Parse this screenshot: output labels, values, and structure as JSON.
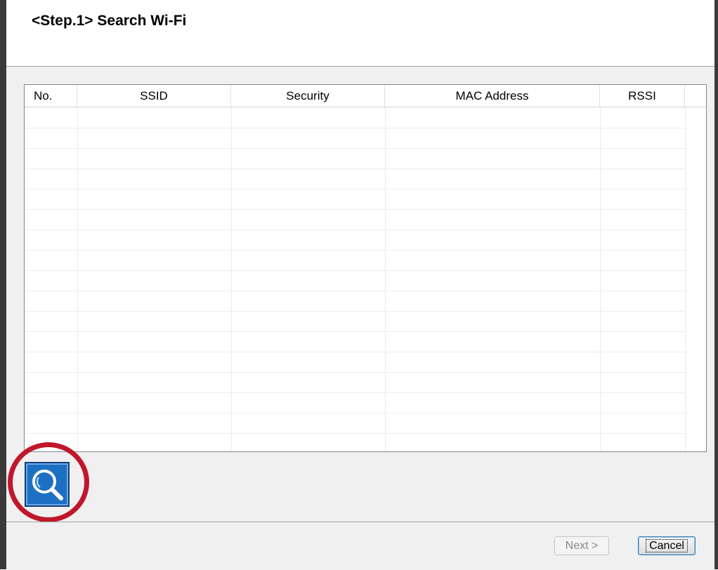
{
  "header": {
    "title": "<Step.1>  Search Wi-Fi"
  },
  "table": {
    "columns": [
      "No.",
      "SSID",
      "Security",
      "MAC Address",
      "RSSI"
    ],
    "rows": []
  },
  "search_button": {
    "icon": "magnifier-icon"
  },
  "footer": {
    "next_label": "Next >",
    "cancel_label": "Cancel",
    "next_enabled": false
  },
  "colors": {
    "search_button": "#1d6fc4",
    "highlight": "#c0172b"
  }
}
